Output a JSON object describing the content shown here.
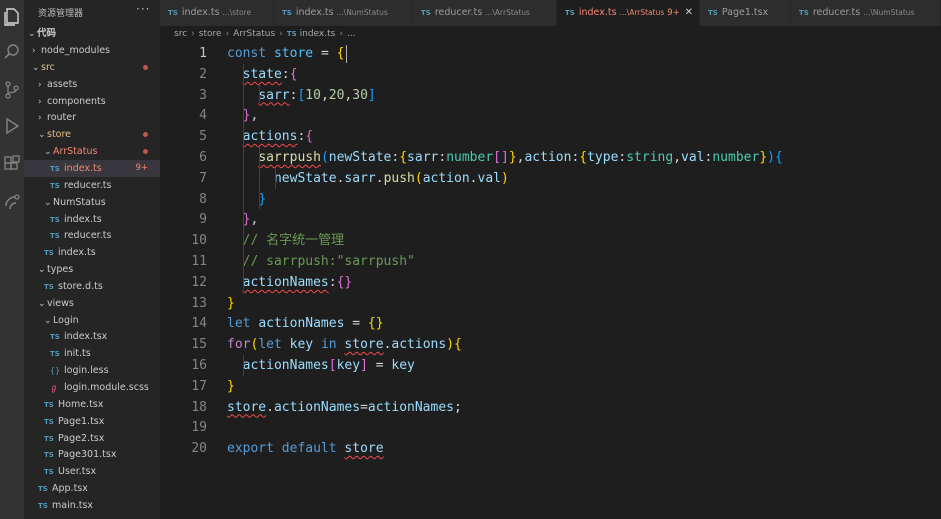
{
  "sidebar": {
    "title": "资源管理器",
    "more": "···",
    "root": "代码",
    "items": [
      {
        "label": "node_modules",
        "kind": "folder",
        "open": false,
        "depth": 1
      },
      {
        "label": "src",
        "kind": "folder",
        "open": true,
        "depth": 1,
        "status": "modified"
      },
      {
        "label": "assets",
        "kind": "folder",
        "open": false,
        "depth": 2
      },
      {
        "label": "components",
        "kind": "folder",
        "open": false,
        "depth": 2
      },
      {
        "label": "router",
        "kind": "folder",
        "open": false,
        "depth": 2
      },
      {
        "label": "store",
        "kind": "folder",
        "open": true,
        "depth": 2,
        "status": "modified"
      },
      {
        "label": "ArrStatus",
        "kind": "folder",
        "open": true,
        "depth": 3,
        "status": "error"
      },
      {
        "label": "index.ts",
        "kind": "ts",
        "depth": 4,
        "status": "error",
        "badge": "9+",
        "selected": true
      },
      {
        "label": "reducer.ts",
        "kind": "ts",
        "depth": 4
      },
      {
        "label": "NumStatus",
        "kind": "folder",
        "open": true,
        "depth": 3
      },
      {
        "label": "index.ts",
        "kind": "ts",
        "depth": 4
      },
      {
        "label": "reducer.ts",
        "kind": "ts",
        "depth": 4
      },
      {
        "label": "index.ts",
        "kind": "ts",
        "depth": 3
      },
      {
        "label": "types",
        "kind": "folder",
        "open": true,
        "depth": 2
      },
      {
        "label": "store.d.ts",
        "kind": "ts",
        "depth": 3
      },
      {
        "label": "views",
        "kind": "folder",
        "open": true,
        "depth": 2
      },
      {
        "label": "Login",
        "kind": "folder",
        "open": true,
        "depth": 3
      },
      {
        "label": "index.tsx",
        "kind": "ts",
        "depth": 4
      },
      {
        "label": "init.ts",
        "kind": "ts",
        "depth": 4
      },
      {
        "label": "login.less",
        "kind": "less",
        "depth": 4
      },
      {
        "label": "login.module.scss",
        "kind": "scss",
        "depth": 4
      },
      {
        "label": "Home.tsx",
        "kind": "ts",
        "depth": 3
      },
      {
        "label": "Page1.tsx",
        "kind": "ts",
        "depth": 3
      },
      {
        "label": "Page2.tsx",
        "kind": "ts",
        "depth": 3
      },
      {
        "label": "Page301.tsx",
        "kind": "ts",
        "depth": 3
      },
      {
        "label": "User.tsx",
        "kind": "ts",
        "depth": 3
      },
      {
        "label": "App.tsx",
        "kind": "ts",
        "depth": 2
      },
      {
        "label": "main.tsx",
        "kind": "ts",
        "depth": 2
      }
    ]
  },
  "tabs": [
    {
      "label": "index.ts",
      "desc": "...\\store",
      "active": false
    },
    {
      "label": "index.ts",
      "desc": "...\\NumStatus",
      "active": false
    },
    {
      "label": "reducer.ts",
      "desc": "...\\ArrStatus",
      "active": false
    },
    {
      "label": "index.ts",
      "desc": "...\\ArrStatus",
      "badge": "9+",
      "active": true,
      "close": "✕"
    },
    {
      "label": "Page1.tsx",
      "desc": "",
      "active": false
    },
    {
      "label": "reducer.ts",
      "desc": "...\\NumStatus",
      "active": false
    }
  ],
  "breadcrumb": [
    "src",
    "store",
    "ArrStatus",
    "index.ts",
    "..."
  ],
  "editor": {
    "current_line": 1,
    "lines": [
      "const store = {",
      "  state:{",
      "    sarr:[10,20,30]",
      "  },",
      "  actions:{",
      "    sarrpush(newState:{sarr:number[]},action:{type:string,val:number}){",
      "      newState.sarr.push(action.val)",
      "    }",
      "  },",
      "  // 名字统一管理",
      "  // sarrpush:\"sarrpush\"",
      "  actionNames:{}",
      "}",
      "let actionNames = {}",
      "for(let key in store.actions){",
      "  actionNames[key] = key",
      "}",
      "store.actionNames=actionNames;",
      "",
      "export default store"
    ]
  },
  "colors": {
    "background": "#1e1e1e",
    "sidebar": "#252526",
    "activity_bar": "#333333",
    "keyword": "#569cd6",
    "control": "#c586c0",
    "variable": "#9cdcfe",
    "function": "#dcdcaa",
    "string": "#ce9178",
    "number": "#b5cea8",
    "comment": "#6a9955",
    "error": "#f48771",
    "modified": "#e2c08d"
  },
  "icons": [
    "files-icon",
    "search-icon",
    "source-control-icon",
    "run-debug-icon",
    "extensions-icon",
    "remote-icon"
  ]
}
